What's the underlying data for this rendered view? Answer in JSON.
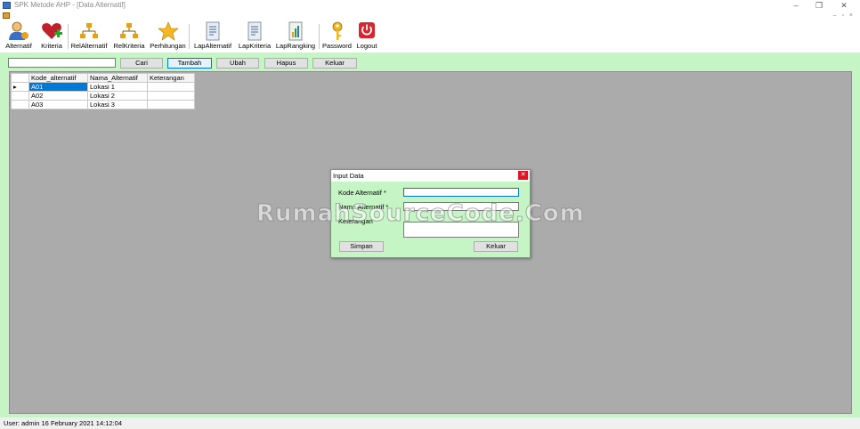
{
  "window": {
    "title": "SPK Metode AHP - [Data Alternatif]"
  },
  "toolbar": {
    "items": [
      {
        "label": "Alternatif",
        "icon": "user-icon"
      },
      {
        "label": "Kriteria",
        "icon": "heart-plus-icon"
      },
      {
        "label": "RelAlternatif",
        "icon": "hierarchy-icon"
      },
      {
        "label": "RelKriteria",
        "icon": "hierarchy-icon"
      },
      {
        "label": "Perhitungan",
        "icon": "star-icon"
      },
      {
        "label": "LapAlternatif",
        "icon": "report-icon"
      },
      {
        "label": "LapKriteria",
        "icon": "report-icon"
      },
      {
        "label": "LapRangking",
        "icon": "report-chart-icon"
      },
      {
        "label": "Password",
        "icon": "key-icon"
      },
      {
        "label": "Logout",
        "icon": "power-icon"
      }
    ]
  },
  "actions": {
    "search_value": "",
    "cari": "Cari",
    "tambah": "Tambah",
    "ubah": "Ubah",
    "hapus": "Hapus",
    "keluar": "Keluar"
  },
  "table": {
    "columns": [
      "Kode_alternatif",
      "Nama_Alternatif",
      "Keterangan"
    ],
    "rows": [
      {
        "kode": "A01",
        "nama": "Lokasi 1",
        "keterangan": ""
      },
      {
        "kode": "A02",
        "nama": "Lokasi 2",
        "keterangan": ""
      },
      {
        "kode": "A03",
        "nama": "Lokasi 3",
        "keterangan": ""
      }
    ],
    "selected_row": 0
  },
  "dialog": {
    "title": "Input Data",
    "kode_label": "Kode Alternatif *",
    "nama_label": "Nama Alternatif *",
    "keterangan_label": "Keterangan",
    "kode_value": "",
    "nama_value": "",
    "keterangan_value": "",
    "simpan": "Simpan",
    "keluar": "Keluar"
  },
  "watermark": "RumahSourceCode.Com",
  "status": {
    "text": "User: admin  16 February 2021 14:12:04"
  },
  "colors": {
    "background_green": "#c5f5c5",
    "selection_blue": "#0078d7",
    "close_red": "#e81123"
  }
}
